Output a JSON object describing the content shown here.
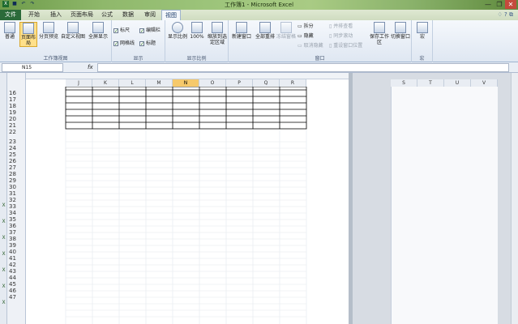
{
  "window": {
    "title": "工作簿1 - Microsoft Excel",
    "controls": [
      "—",
      "❐",
      "✕"
    ]
  },
  "qat": {
    "icons": [
      "excel-logo",
      "save",
      "undo",
      "redo"
    ]
  },
  "tabs": [
    {
      "label": "文件",
      "active": false,
      "file": true
    },
    {
      "label": "开始",
      "active": false
    },
    {
      "label": "插入",
      "active": false
    },
    {
      "label": "页面布局",
      "active": false
    },
    {
      "label": "公式",
      "active": false
    },
    {
      "label": "数据",
      "active": false
    },
    {
      "label": "审阅",
      "active": false
    },
    {
      "label": "视图",
      "active": true
    }
  ],
  "ribbon": {
    "group1": {
      "label": "工作簿视图",
      "normal": "普通",
      "page_layout": "页面布局",
      "page_break": "分页预览",
      "custom_views": "自定义视图",
      "fullscreen": "全屏显示"
    },
    "group2": {
      "label": "显示",
      "ruler": "标尺",
      "edit_bar": "编辑栏",
      "gridlines": "网格线",
      "headings": "标题"
    },
    "group3": {
      "label": "显示比例",
      "zoom": "显示比例",
      "zoom100": "100%",
      "zoom_sel": "缩放到选定区域"
    },
    "group4": {
      "label": "窗口",
      "new_window": "新建窗口",
      "arrange_all": "全部重排",
      "freeze": "冻结窗格",
      "split": "拆分",
      "hide": "隐藏",
      "unhide": "取消隐藏",
      "side_by_side": "并排查看",
      "sync_scroll": "同步滚动",
      "reset_pos": "重设窗口位置",
      "save_workspace": "保存工作区",
      "switch_windows": "切换窗口"
    },
    "group5": {
      "label": "宏",
      "macro": "宏"
    }
  },
  "formula": {
    "name_box": "N15",
    "fx": "fx",
    "value": ""
  },
  "columns_left": [
    "J",
    "K",
    "L",
    "M",
    "N",
    "O",
    "P",
    "Q",
    "R"
  ],
  "columns_right": [
    "S",
    "T",
    "U",
    "V"
  ],
  "selected_column": "N",
  "rows": [
    "16",
    "17",
    "18",
    "19",
    "20",
    "21",
    "22",
    "23",
    "24",
    "25",
    "26",
    "27",
    "28",
    "29",
    "30",
    "31",
    "32",
    "33",
    "34",
    "35",
    "36",
    "37",
    "38",
    "39",
    "40",
    "41",
    "42",
    "43",
    "44",
    "45",
    "46",
    "47"
  ]
}
